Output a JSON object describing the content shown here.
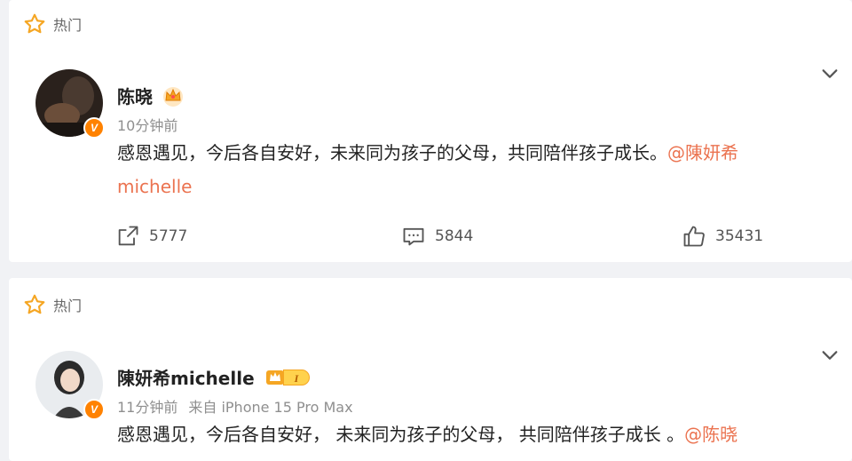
{
  "posts": [
    {
      "hot_label": "热门",
      "username": "陈晓",
      "time": "10分钟前",
      "source": "",
      "text": "感恩遇见，今后各自安好，未来同为孩子的父母，共同陪伴孩子成长。",
      "mention_line1": "@陳妍希",
      "mention_line2": "michelle",
      "repost_count": "5777",
      "comment_count": "5844",
      "like_count": "35431",
      "verified_badge": "V"
    },
    {
      "hot_label": "热门",
      "username": "陳妍希michelle",
      "time": "11分钟前",
      "source": "来自 iPhone 15 Pro Max",
      "text": "感恩遇见，今后各自安好， 未来同为孩子的父母， 共同陪伴孩子成长 。",
      "mention": "@陈晓",
      "level_badge": "I",
      "verified_badge": "V"
    }
  ],
  "colors": {
    "accent": "#ff8200",
    "mention": "#eb7350",
    "background": "#f1f2f5"
  },
  "icons": [
    "star-icon",
    "chevron-down-icon",
    "crown-icon",
    "repost-icon",
    "comment-icon",
    "like-icon"
  ]
}
